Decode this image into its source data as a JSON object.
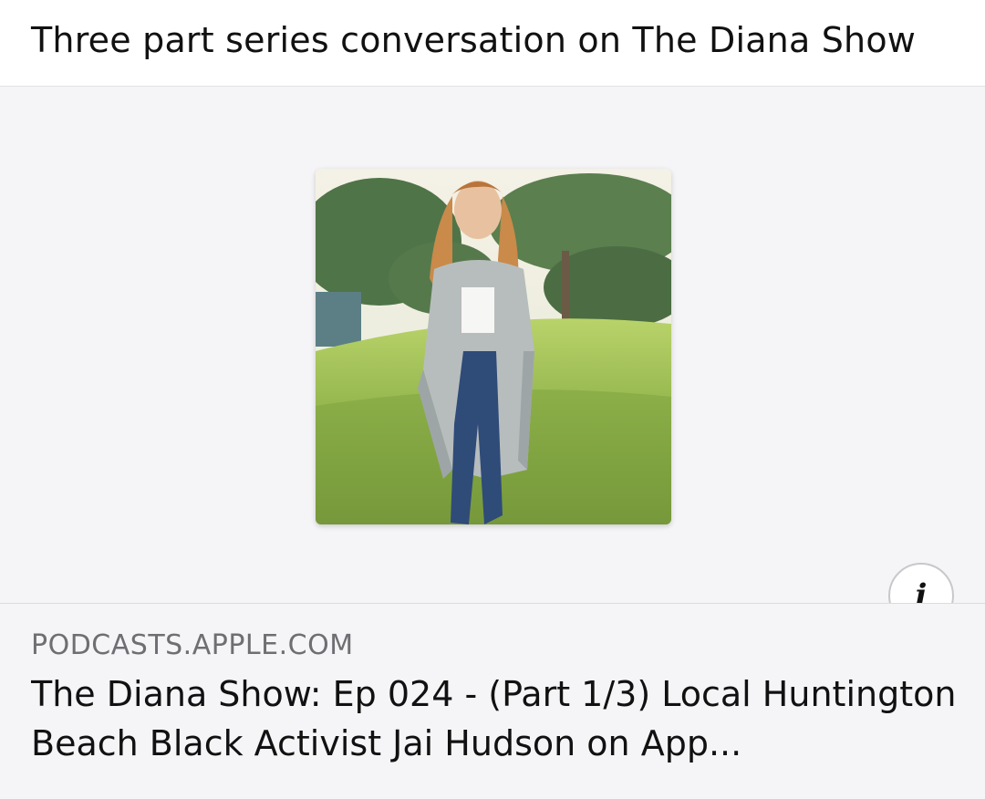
{
  "post": {
    "text": "Three part series conversation on The Diana Show"
  },
  "link_preview": {
    "artwork_icon": "podcast-artwork-image",
    "info_button_glyph": "i",
    "domain": "PODCASTS.APPLE.COM",
    "title": "The Diana Show: Ep 024 - (Part 1/3) Local Huntington Beach Black Activist Jai Hudson on App..."
  }
}
